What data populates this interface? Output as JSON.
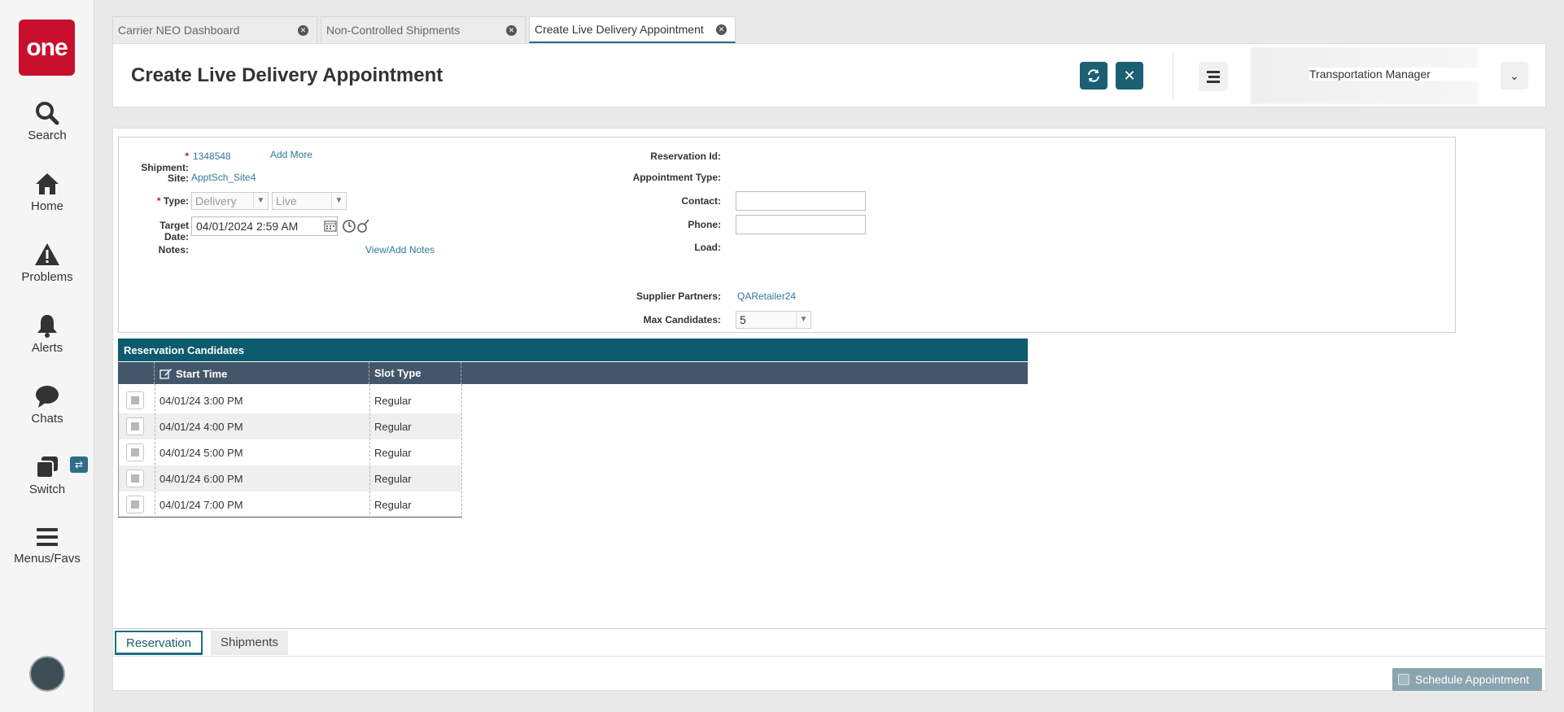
{
  "nav": {
    "logo": "one",
    "items": [
      {
        "label": "Search",
        "icon": "search-icon"
      },
      {
        "label": "Home",
        "icon": "home-icon"
      },
      {
        "label": "Problems",
        "icon": "warning-icon"
      },
      {
        "label": "Alerts",
        "icon": "bell-icon"
      },
      {
        "label": "Chats",
        "icon": "chat-icon"
      },
      {
        "label": "Switch",
        "icon": "switch-icon"
      },
      {
        "label": "Menus/Favs",
        "icon": "menu-icon"
      }
    ]
  },
  "tabs": [
    {
      "label": "Carrier NEO Dashboard",
      "active": false
    },
    {
      "label": "Non-Controlled Shipments",
      "active": false
    },
    {
      "label": "Create Live Delivery Appointment",
      "active": true
    }
  ],
  "header": {
    "title": "Create Live Delivery Appointment",
    "user_role": "Transportation Manager",
    "accent": "#1b5f73"
  },
  "form": {
    "shipment_label": "Shipment:",
    "shipment_value": "1348548",
    "add_more": "Add More",
    "site_label": "Site:",
    "site_value": "ApptSch_Site4",
    "type_label": "Type:",
    "type_value": "Delivery",
    "mode_value": "Live",
    "target_date_label": "Target Date:",
    "target_date_value": "04/01/2024 2:59 AM",
    "notes_label": "Notes:",
    "notes_link": "View/Add Notes",
    "reservation_id_label": "Reservation Id:",
    "appointment_type_label": "Appointment Type:",
    "contact_label": "Contact:",
    "phone_label": "Phone:",
    "load_label": "Load:",
    "supplier_partners_label": "Supplier Partners:",
    "supplier_partners_value": "QARetailer24",
    "max_candidates_label": "Max Candidates:",
    "max_candidates_value": "5"
  },
  "grid": {
    "title": "Reservation Candidates",
    "columns": [
      "Start Time",
      "Slot Type"
    ],
    "rows": [
      {
        "start": "04/01/24 3:00 PM",
        "slot": "Regular"
      },
      {
        "start": "04/01/24 4:00 PM",
        "slot": "Regular"
      },
      {
        "start": "04/01/24 5:00 PM",
        "slot": "Regular"
      },
      {
        "start": "04/01/24 6:00 PM",
        "slot": "Regular"
      },
      {
        "start": "04/01/24 7:00 PM",
        "slot": "Regular"
      }
    ]
  },
  "bottom_tabs": [
    {
      "label": "Reservation",
      "active": true
    },
    {
      "label": "Shipments",
      "active": false
    }
  ],
  "schedule_button": "Schedule Appointment"
}
